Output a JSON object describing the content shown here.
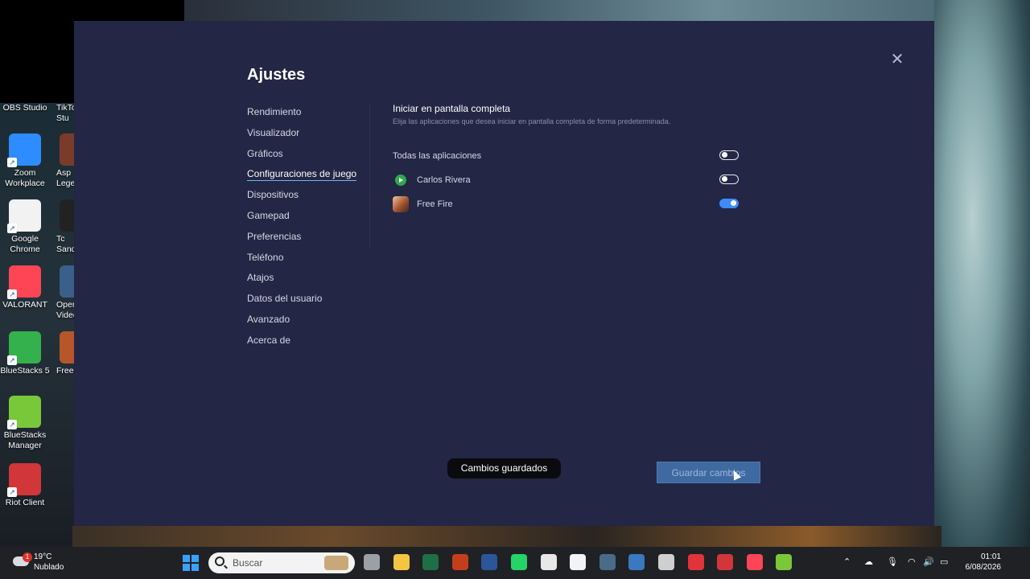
{
  "desktop": {
    "icons_full": [
      {
        "label": "OBS Studio",
        "color": "#000000"
      },
      {
        "label": "Zoom Workplace",
        "color": "#2d8cff"
      },
      {
        "label": "Google Chrome",
        "color": "#f2f2f2"
      },
      {
        "label": "VALORANT",
        "color": "#fd4556"
      },
      {
        "label": "BlueStacks 5",
        "color": "#34b04c"
      },
      {
        "label": "BlueStacks Manager",
        "color": "#79c83a"
      },
      {
        "label": "Riot Client",
        "color": "#d13639"
      }
    ],
    "icons_partial": [
      {
        "label": "TikTo Stu",
        "color": "#111111"
      },
      {
        "label": "Asp Lege",
        "color": "#7a3b2a"
      },
      {
        "label": "Tc Sand",
        "color": "#222222"
      },
      {
        "label": "Oper Video",
        "color": "#3a5f8a"
      },
      {
        "label": "Free",
        "color": "#b5572b"
      }
    ]
  },
  "dialog": {
    "title": "Ajustes",
    "close_icon": "close-icon",
    "nav": [
      {
        "label": "Rendimiento",
        "active": false
      },
      {
        "label": "Visualizador",
        "active": false
      },
      {
        "label": "Gráficos",
        "active": false
      },
      {
        "label": "Configuraciones de juego",
        "active": true
      },
      {
        "label": "Dispositivos",
        "active": false
      },
      {
        "label": "Gamepad",
        "active": false
      },
      {
        "label": "Preferencias",
        "active": false
      },
      {
        "label": "Teléfono",
        "active": false
      },
      {
        "label": "Atajos",
        "active": false
      },
      {
        "label": "Datos del usuario",
        "active": false
      },
      {
        "label": "Avanzado",
        "active": false
      },
      {
        "label": "Acerca de",
        "active": false
      }
    ],
    "section": {
      "title": "Iniciar en pantalla completa",
      "subtitle": "Elija las aplicaciones que desea iniciar en pantalla completa de forma predeterminada."
    },
    "rows": [
      {
        "label": "Todas las aplicaciones",
        "icon": "",
        "enabled": false
      },
      {
        "label": "Carlos Rivera",
        "icon": "play-store-icon",
        "enabled": false
      },
      {
        "label": "Free Fire",
        "icon": "free-fire-icon",
        "enabled": true
      }
    ],
    "toast": "Cambios guardados",
    "save_button": "Guardar cambios"
  },
  "taskbar": {
    "weather_badge": "1",
    "temperature": "19°C",
    "condition": "Nublado",
    "search_placeholder": "Buscar",
    "apps": [
      {
        "name": "task-view-icon",
        "color": "#9aa0a6"
      },
      {
        "name": "file-explorer-icon",
        "color": "#f5c542"
      },
      {
        "name": "excel-icon",
        "color": "#1d7044"
      },
      {
        "name": "powerpoint-icon",
        "color": "#c43e1c"
      },
      {
        "name": "word-icon",
        "color": "#2b579a"
      },
      {
        "name": "whatsapp-icon",
        "color": "#25d366"
      },
      {
        "name": "chrome-icon",
        "color": "#e8e8e8"
      },
      {
        "name": "microsoft-store-icon",
        "color": "#f3f3f3"
      },
      {
        "name": "keyboard-app-icon",
        "color": "#4a6a8a"
      },
      {
        "name": "browser-icon",
        "color": "#3a78c2"
      },
      {
        "name": "steam-like-icon",
        "color": "#cfcfcf"
      },
      {
        "name": "record-app-icon",
        "color": "#e2333b"
      },
      {
        "name": "riot-client-icon",
        "color": "#d13639"
      },
      {
        "name": "valorant-icon",
        "color": "#fd4556"
      },
      {
        "name": "bluestacks-icon",
        "color": "#79c83a"
      }
    ],
    "time": "01:01",
    "date": "6/08/2026"
  }
}
